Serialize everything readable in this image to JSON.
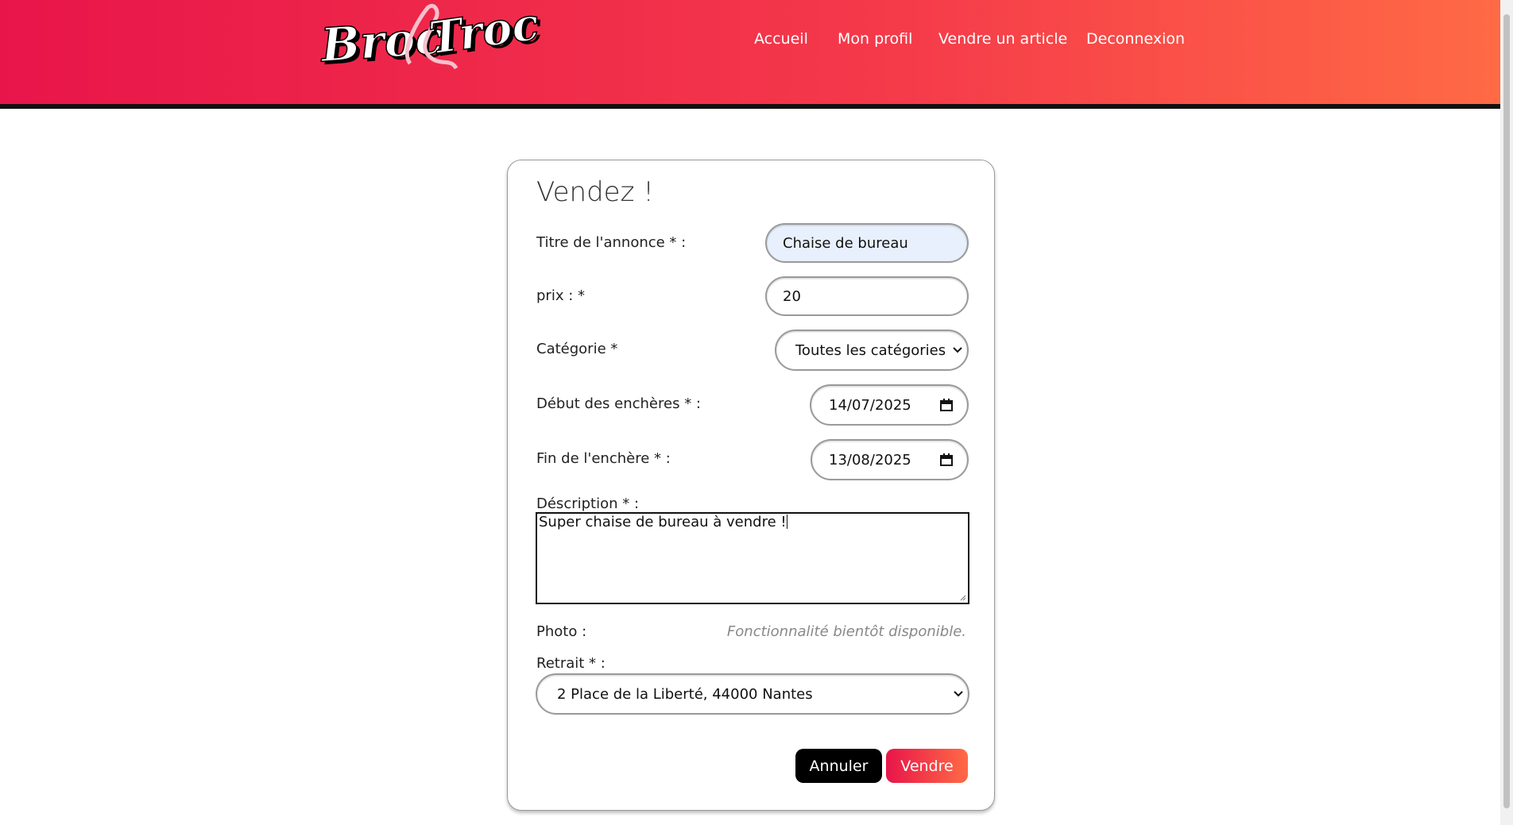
{
  "header": {
    "logo_text": "Broc&Troc",
    "nav": [
      "Accueil",
      "Mon profil",
      "Vendre un article",
      "Deconnexion"
    ]
  },
  "form": {
    "title": "Vendez !",
    "title_label": "Titre de l'annonce * :",
    "title_value": "Chaise de bureau",
    "price_label": "prix : *",
    "price_value": "20",
    "category_label": "Catégorie *",
    "category_value": "Toutes les catégories",
    "start_label": "Début des enchères * :",
    "start_value": "14/07/2025",
    "end_label": "Fin de l'enchère * :",
    "end_value": "13/08/2025",
    "description_label": "Déscription * :",
    "description_value": "Super chaise de bureau à vendre !",
    "photo_label": "Photo :",
    "photo_note": "Fonctionnalité bientôt disponible.",
    "pickup_label": "Retrait * :",
    "pickup_value": "2 Place de la Liberté, 44000 Nantes",
    "cancel_label": "Annuler",
    "submit_label": "Vendre"
  },
  "colors": {
    "brand_start": "#e8154a",
    "brand_end": "#ff6a45",
    "autofill_bg": "#e8f0fe"
  },
  "icons": [
    "calendar-icon",
    "chevron-down-icon",
    "logo"
  ]
}
